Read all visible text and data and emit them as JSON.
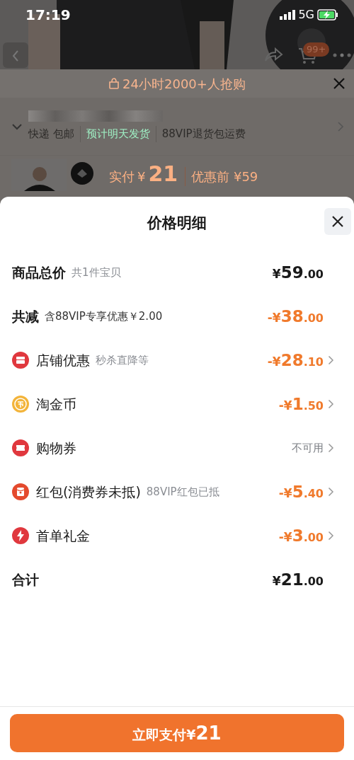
{
  "status_bar": {
    "time": "17:19",
    "network": "5G"
  },
  "product_page": {
    "cart_badge": "99+",
    "banner": "24小时2000+人抢购",
    "delivery": [
      {
        "text": "快递 包邮",
        "color": "#2e2c2a"
      },
      {
        "text": "预计明天发货",
        "color": "#9ff0c4"
      },
      {
        "text": "88VIP退货包运费",
        "color": "#2e2c2a"
      }
    ],
    "pay_label": "实付",
    "pay_currency": "¥",
    "pay_amount": "21",
    "before_label": "优惠前",
    "before_amount": "¥59"
  },
  "sheet": {
    "title": "价格明细",
    "rows": [
      {
        "kind": "summary",
        "label": "商品总价",
        "note": "共1件宝贝",
        "prefix": "¥",
        "amount": "59",
        "decimal": ".00",
        "discount": false,
        "chevron": false
      },
      {
        "kind": "summary",
        "label": "共减",
        "note": "含88VIP专享优惠￥2.00",
        "prefix": "-¥",
        "amount": "38",
        "decimal": ".00",
        "discount": true,
        "chevron": false
      },
      {
        "kind": "item",
        "label": "店铺优惠",
        "note": "秒杀直降等",
        "prefix": "-¥",
        "amount": "28",
        "decimal": ".10",
        "discount": true,
        "chevron": true
      },
      {
        "kind": "item",
        "label": "淘金币",
        "prefix": "-¥",
        "amount": "1",
        "decimal": ".50",
        "discount": true,
        "chevron": true
      },
      {
        "kind": "item",
        "label": "购物券",
        "status": "不可用",
        "chevron": true
      },
      {
        "kind": "item",
        "label": "红包(消费券未抵)",
        "note": "88VIP红包已抵",
        "prefix": "-¥",
        "amount": "5",
        "decimal": ".40",
        "discount": true,
        "chevron": true
      },
      {
        "kind": "item",
        "label": "首单礼金",
        "prefix": "-¥",
        "amount": "3",
        "decimal": ".00",
        "discount": true,
        "chevron": true
      },
      {
        "kind": "summary",
        "label": "合计",
        "prefix": "¥",
        "amount": "21",
        "decimal": ".00",
        "discount": false,
        "chevron": false
      }
    ]
  },
  "pay_button": {
    "label": "立即支付",
    "currency": "¥",
    "amount": "21"
  }
}
